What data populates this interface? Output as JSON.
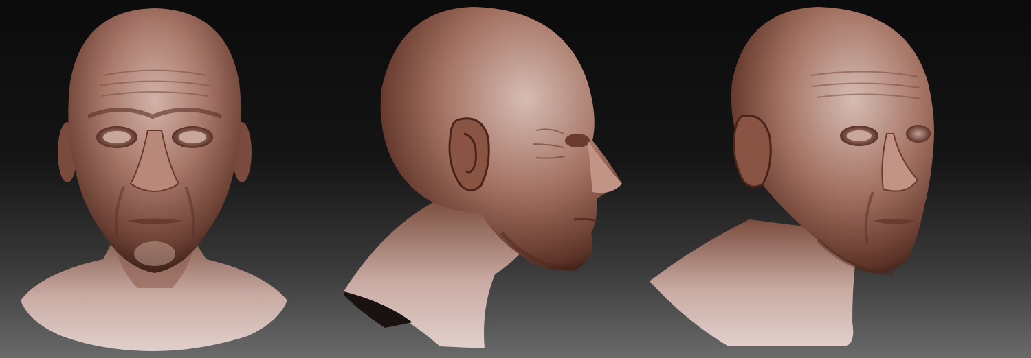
{
  "scene": {
    "background_top": "#0b0b0b",
    "background_bottom": "#6a6a6a",
    "clay_base": "#9a6a5a",
    "clay_highlight": "#d9c2bc",
    "clay_shadow": "#4a2a22"
  },
  "views": [
    {
      "name": "front"
    },
    {
      "name": "profile-right"
    },
    {
      "name": "three-quarter-right"
    }
  ]
}
